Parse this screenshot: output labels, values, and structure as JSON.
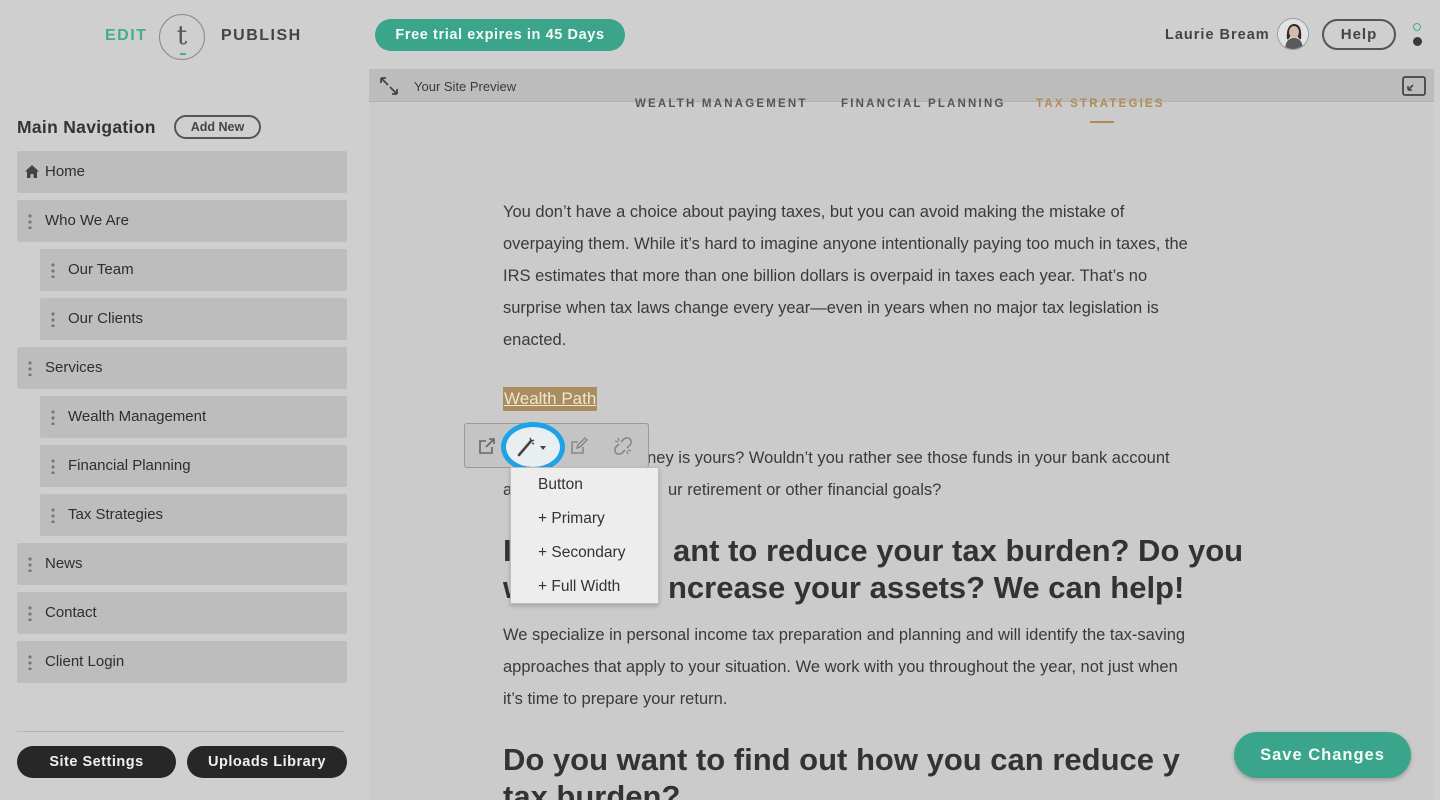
{
  "header": {
    "edit_label": "EDIT",
    "logo_letter": "t",
    "publish_label": "PUBLISH",
    "trial_badge": "Free trial expires in 45 Days",
    "user_name": "Laurie Bream",
    "help_label": "Help"
  },
  "sidebar": {
    "heading": "Main Navigation",
    "add_new_label": "Add New",
    "items": [
      {
        "label": "Home"
      },
      {
        "label": "Who We Are"
      },
      {
        "label": "Our Team"
      },
      {
        "label": "Our Clients"
      },
      {
        "label": "Services"
      },
      {
        "label": "Wealth Management"
      },
      {
        "label": "Financial Planning"
      },
      {
        "label": "Tax Strategies"
      },
      {
        "label": "News"
      },
      {
        "label": "Contact"
      },
      {
        "label": "Client Login"
      }
    ],
    "site_settings_label": "Site Settings",
    "uploads_library_label": "Uploads Library"
  },
  "preview": {
    "title": "Your Site Preview",
    "site_nav": [
      "WEALTH MANAGEMENT",
      "FINANCIAL PLANNING",
      "TAX STRATEGIES"
    ],
    "intro_lines": [
      "You don’t have a choice about paying taxes, but you can avoid making the mistake of",
      "overpaying them. While it’s hard to imagine anyone intentionally paying too much in taxes, the",
      "IRS estimates that more than one billion dollars is overpaid in taxes each year. That’s no",
      "surprise when tax laws change every year—even in years when no major tax legislation is",
      "enacted."
    ],
    "selected_link": "Wealth Path",
    "partial_lines": [
      "t money is yours? Wouldn’t you rather see those funds in your bank account",
      "ur retirement or other financial goals?"
    ],
    "partial_line_1_prefix": "a",
    "heading1_part_a": "ant to reduce your tax burden? Do you",
    "heading1_part_b": "ncrease your assets? We can help!",
    "heading1_lead_a": "I",
    "heading1_lead_b": "w",
    "body_lines": [
      "We specialize in personal income tax preparation and planning and will identify the tax-saving",
      "approaches that apply to your situation. We work with you throughout the year, not just when",
      "it’s time to prepare your return."
    ],
    "heading2_line1": "Do you want to find out how you can reduce y",
    "heading2_line2": "tax burden?",
    "dropdown": {
      "title": "Button",
      "items": [
        "+ Primary",
        "+ Secondary",
        "+ Full Width"
      ]
    }
  },
  "save_label": "Save Changes",
  "colors": {
    "accent_green": "#3aa58a",
    "highlight_blue": "#1ea2e8",
    "gold": "#b08c55"
  }
}
